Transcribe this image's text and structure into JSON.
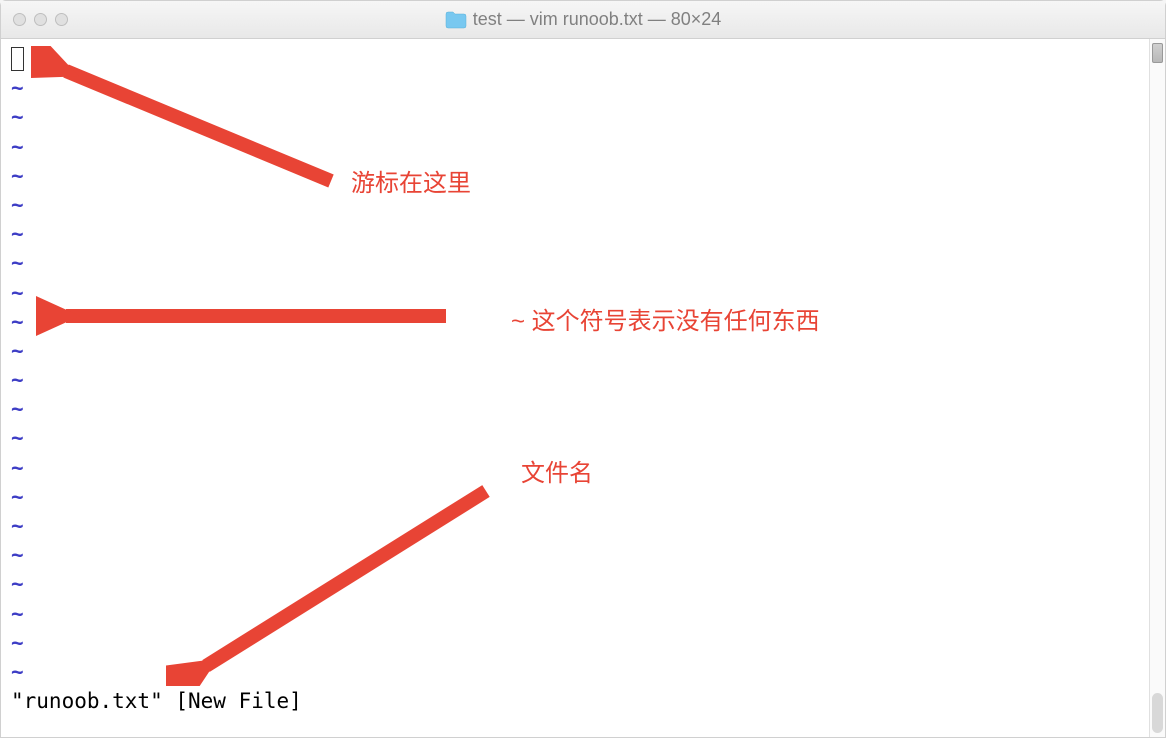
{
  "window": {
    "title": "test — vim runoob.txt — 80×24"
  },
  "terminal": {
    "tilde": "~",
    "status_line": "\"runoob.txt\" [New File]"
  },
  "annotations": {
    "cursor_label": "游标在这里",
    "tilde_label": "~ 这个符号表示没有任何东西",
    "filename_label": "文件名"
  },
  "colors": {
    "annotation_red": "#e84435",
    "tilde_blue": "#3d3dc5",
    "folder_blue": "#78c8f0"
  }
}
